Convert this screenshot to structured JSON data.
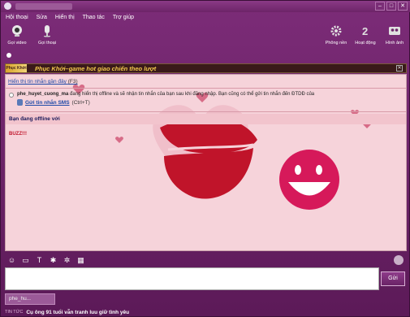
{
  "titlebar": {
    "buttons": [
      "–",
      "□",
      "✕"
    ]
  },
  "menu": {
    "items": [
      "Hội thoại",
      "Sửa",
      "Hiển thị",
      "Thao tác",
      "Trợ giúp"
    ]
  },
  "toolbar": {
    "left": [
      {
        "label": "Gọi video",
        "icon": "webcam-icon",
        "color": "#e8e8e8"
      },
      {
        "label": "Gọi thoại",
        "icon": "microphone-icon",
        "color": "#e8e8e8"
      }
    ],
    "right": [
      {
        "label": "Phông nền",
        "icon": "gear-icon",
        "color": "#e0e0e0"
      },
      {
        "label": "Hoạt động",
        "icon": "number-2-icon",
        "color": "#e0e0e0"
      },
      {
        "label": "Hình ảnh",
        "icon": "contacts-icon",
        "color": "#e0e0e0"
      }
    ]
  },
  "banner": {
    "logo": "Phục Khởi",
    "text": "Phục Khởi–game hot giao chiến theo lượt"
  },
  "chat": {
    "history_link": "Hiển thị tin nhắn gần đây",
    "history_key": "(F3)",
    "offline_user": "phe_huyet_cuong_ma",
    "offline_text": " đang hiển thị offline và sẽ nhận tin nhắn của bạn sau khi đăng nhập. Bạn cũng có thể gửi tin nhắn đến ĐTDĐ của",
    "sms_link": "Gửi tin nhắn SMS",
    "sms_key": "(Ctrl+T)",
    "offline_notice": "Bạn đang offline với",
    "buzz": "BUZZ!!!"
  },
  "input": {
    "send_label": "Gửi"
  },
  "tabs": {
    "conversation": "phe_hu..."
  },
  "news": {
    "label": "TIN TỨC",
    "text": "Cụ ông 91 tuổi vẫn tranh luu giữ tình yêu"
  },
  "colors": {
    "accent": "#6d2468",
    "chat_bg": "#f6d3da",
    "lips": "#c0142a",
    "smiley": "#d6195a"
  }
}
